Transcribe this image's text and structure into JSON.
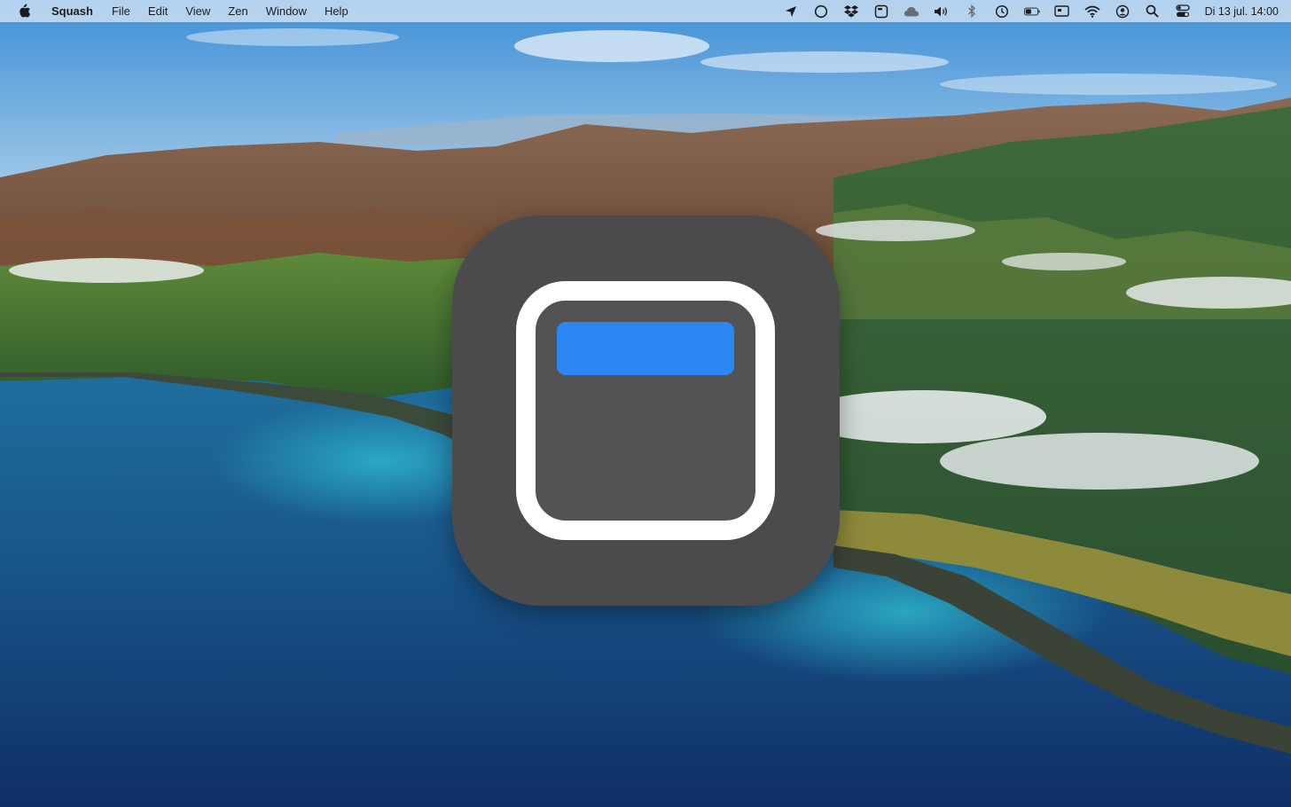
{
  "menu_bar": {
    "apple_icon": "apple-logo-icon",
    "app_name": "Squash",
    "items": [
      "File",
      "Edit",
      "View",
      "Zen",
      "Window",
      "Help"
    ],
    "status_icons": [
      "location-arrow-icon",
      "circle-icon",
      "dropbox-icon",
      "app-window-icon",
      "cloud-icon",
      "volume-icon",
      "bluetooth-icon",
      "time-machine-icon",
      "battery-icon",
      "display-icon",
      "wifi-icon",
      "user-icon",
      "search-icon",
      "control-center-icon"
    ],
    "clock": "Di 13 jul.  14:00"
  },
  "app_icon": {
    "name": "squash-app-icon",
    "background_color": "#4b4a4c",
    "frame_color": "#ffffff",
    "title_bar_color": "#2c86f2"
  },
  "wallpaper": "big-sur-coastline"
}
